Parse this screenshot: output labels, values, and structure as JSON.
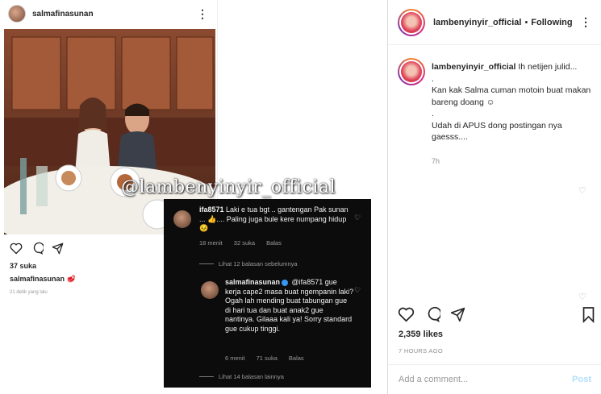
{
  "left_post": {
    "username": "salmafinasunan",
    "more_icon": "more-icon",
    "likes": "37 suka",
    "caption_user": "salmafinasunan",
    "caption_emoji": "🥩",
    "time_ago": "21 detik yang lalu"
  },
  "watermark": "@lambenyinyir_official",
  "dark_comments": {
    "comment1": {
      "username": "ifa8571",
      "text": "Laki e tua bgt .. gantengan Pak sunan ... 👍.... Paling juga bule kere numpang hidup😣",
      "time": "18 menit",
      "likes": "32 suka",
      "reply": "Balas"
    },
    "view_prev": "Lihat 12 balasan sebelumnya",
    "reply1": {
      "username": "salmafinasunan",
      "mention": "@ifa8571",
      "text": "gue kerja cape2 masa buat ngempanin laki? Ogah lah mending buat tabungan gue di hari tua dan buat anak2 gue nantinya. Gilaaa kali ya! Sorry standard gue cukup tinggi.",
      "time": "6 menit",
      "likes": "71 suka",
      "reply": "Balas"
    },
    "view_more": "Lihat 14 balasan lainnya"
  },
  "right_panel": {
    "username": "lambenyinyir_official",
    "dot": "•",
    "follow_status": "Following",
    "comment_user": "lambenyinyir_official",
    "comment_lines": [
      "Ih netijen julid...",
      ".",
      "Kan kak Salma cuman motoin buat makan bareng doang ☺",
      ".",
      "Udah di APUS dong postingan nya gaesss...."
    ],
    "comment_age": "7h",
    "likes": "2,359 likes",
    "date": "7 HOURS AGO",
    "add_comment_placeholder": "Add a comment...",
    "post_label": "Post"
  },
  "colors": {
    "link_disabled": "#b2dffc",
    "verified": "#3897f0",
    "dark_bg": "#0c0c0c"
  }
}
